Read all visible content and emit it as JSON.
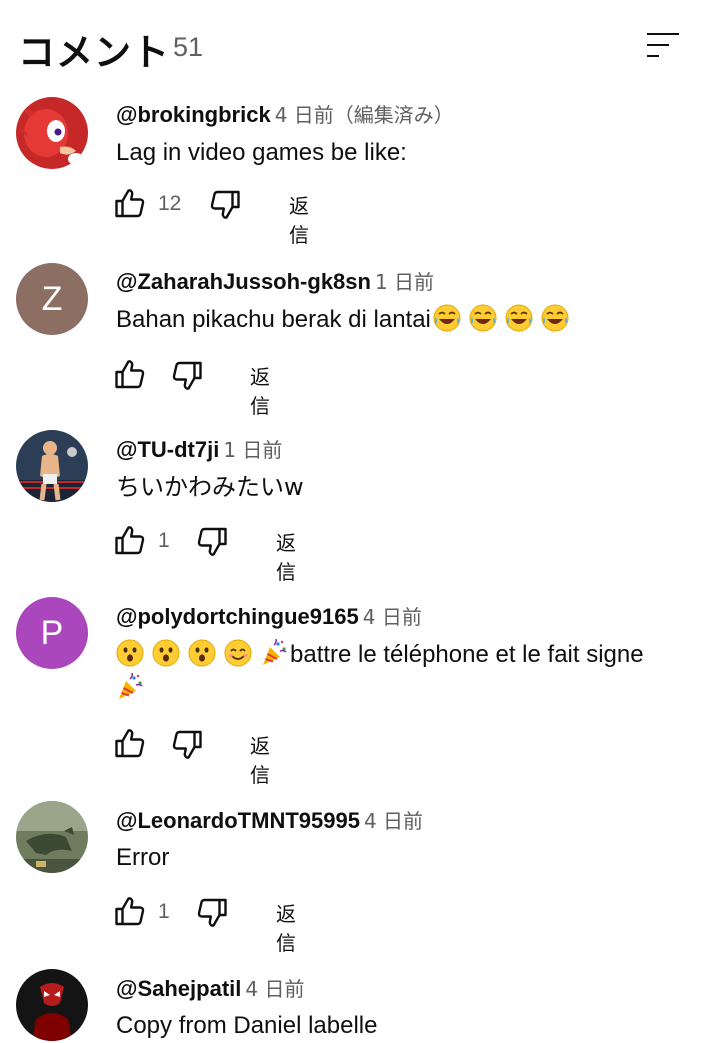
{
  "header": {
    "title": "コメント",
    "count": "51"
  },
  "reply_label": "返信",
  "comments": [
    {
      "author": "@brokingbrick",
      "time": "4 日前（編集済み）",
      "text": "Lag in video games be like:",
      "likes": "12",
      "avatar_color": "#d32f2f"
    },
    {
      "author": "@ZaharahJussoh-gk8sn",
      "time": "1 日前",
      "text": "Bahan pikachu berak di lantai",
      "text_emoji": [
        "laugh-cry-emoji",
        "laugh-cry-emoji",
        "laugh-cry-emoji",
        "laugh-cry-emoji"
      ],
      "likes": "",
      "avatar_letter": "Z",
      "avatar_color": "#8d6e63"
    },
    {
      "author": "@TU-dt7ji",
      "time": "1 日前",
      "text": "ちいかわみたいw",
      "likes": "1",
      "avatar_color": "#3a4a5a"
    },
    {
      "author": "@polydortchingue9165",
      "time": "4 日前",
      "text_before_emoji": [
        "astonished-emoji",
        "astonished-emoji",
        "astonished-emoji",
        "smile-emoji",
        "party-popper-emoji"
      ],
      "text": "battre le téléphone et le fait signe",
      "text_after_emoji": [
        "party-popper-emoji"
      ],
      "likes": "",
      "avatar_letter": "P",
      "avatar_color": "#ab47bc"
    },
    {
      "author": "@LeonardoTMNT95995",
      "time": "4 日前",
      "text": "Error",
      "likes": "1",
      "avatar_color": "#4e5d43"
    },
    {
      "author": "@Sahejpatil",
      "time": "4 日前",
      "text": "Copy from Daniel labelle",
      "likes": "",
      "avatar_color": "#1a1a1a"
    }
  ]
}
